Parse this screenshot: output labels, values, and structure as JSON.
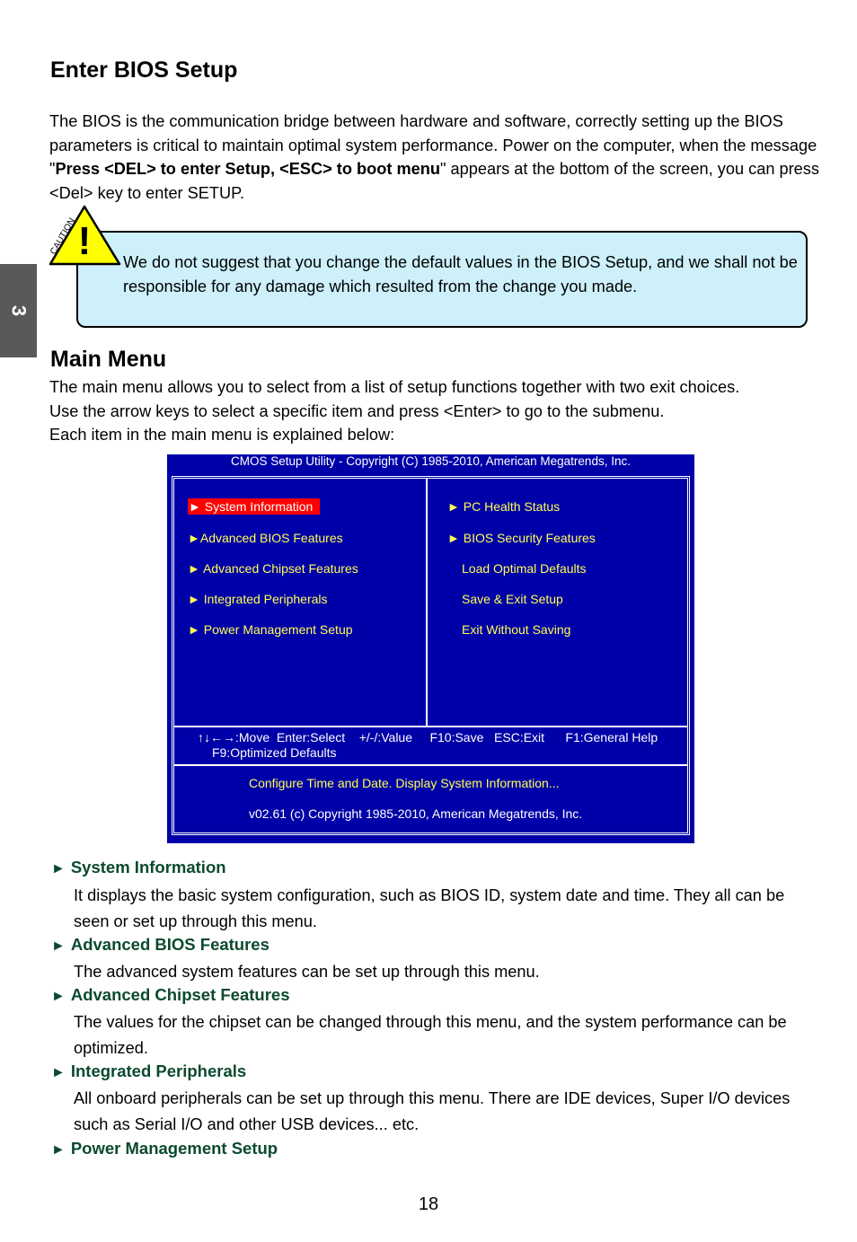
{
  "chapter_tab": "3",
  "section1": {
    "title": "Enter BIOS Setup",
    "para_part1": "The BIOS is the communication bridge between hardware and software, correctly setting up the BIOS parameters is critical to maintain optimal system performance. Power on the computer, when the message \"",
    "para_bold": "Press <DEL> to enter Setup, <ESC> to boot menu",
    "para_part2": "\" appears at the bottom of the screen, you can press <Del> key to enter SETUP."
  },
  "caution": {
    "icon_label": "CAUTION",
    "icon_symbol": "!",
    "text": "We do not suggest that you change the default values in the BIOS Setup, and we shall not be responsible for any damage which resulted from the change you made.",
    "colors": {
      "box": "#cdf0fb",
      "triangle": "#ffff00"
    }
  },
  "section2": {
    "title": "Main Menu",
    "lines": [
      "The main menu allows you to select from a list of setup functions together with two exit choices.",
      "Use the arrow keys to select a specific item and press <Enter> to go to the submenu.",
      "Each item in the main menu is explained below:"
    ]
  },
  "bios_screen": {
    "colors": {
      "background": "#0000a8",
      "item_text": "#ffff55",
      "selected_bg": "#ff0000"
    },
    "title": "CMOS Setup Utility - Copyright (C) 1985-2010, American Megatrends, Inc.",
    "left_items": [
      {
        "label": "► System Information",
        "selected": true
      },
      {
        "label": "►Advanced BIOS Features",
        "selected": false
      },
      {
        "label": "► Advanced Chipset Features",
        "selected": false
      },
      {
        "label": "► Integrated Peripherals",
        "selected": false
      },
      {
        "label": "► Power Management Setup",
        "selected": false
      }
    ],
    "right_items": [
      {
        "label": "► PC Health Status"
      },
      {
        "label": "► BIOS Security Features"
      },
      {
        "label": "Load Optimal Defaults"
      },
      {
        "label": "Save & Exit Setup"
      },
      {
        "label": "Exit Without Saving"
      }
    ],
    "keys_line1": "↑↓←→:Move  Enter:Select    +/-/:Value     F10:Save   ESC:Exit      F1:General Help",
    "keys_line2": "F9:Optimized Defaults",
    "help_text": "Configure Time and Date.  Display System Information...",
    "version_text": "v02.61   (c) Copyright 1985-2010, American Megatrends, Inc."
  },
  "descriptions": [
    {
      "heading": "System Information",
      "body": "It displays the basic system configuration, such as BIOS ID, system date and time. They all can be seen or set up through this menu."
    },
    {
      "heading": "Advanced BIOS Features",
      "body": "The advanced system features can be set up through this menu."
    },
    {
      "heading": "Advanced Chipset Features",
      "body": "The values for the chipset can be changed through this menu, and the system performance can be optimized."
    },
    {
      "heading": "Integrated Peripherals",
      "body": "All onboard peripherals can be set up through this menu. There are IDE devices, Super I/O devices such as Serial I/O and other USB devices... etc."
    },
    {
      "heading": "Power Management Setup",
      "body": ""
    }
  ],
  "heading_arrow": "►",
  "page_number": "18"
}
